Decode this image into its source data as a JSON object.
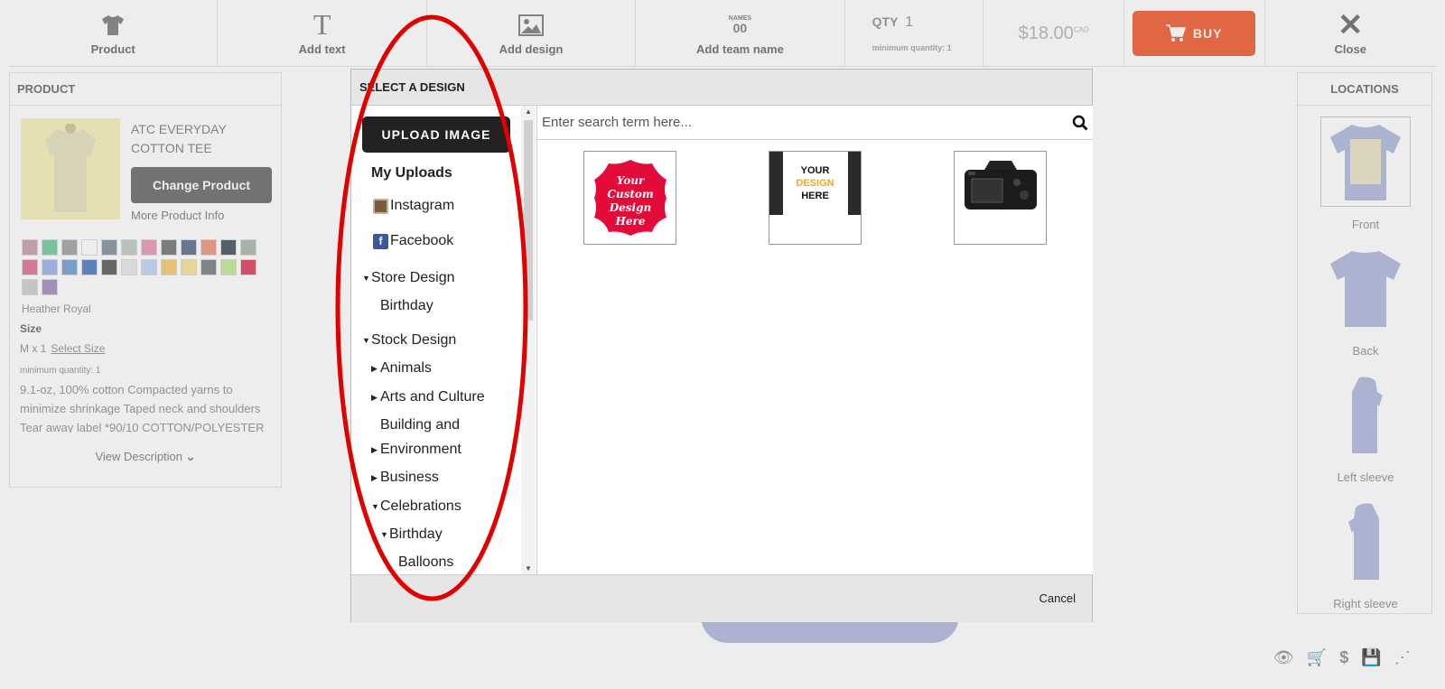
{
  "toolbar": {
    "product": "Product",
    "add_text": "Add text",
    "add_design": "Add design",
    "add_team_name": "Add team name",
    "team_icon_top": "NAMES",
    "team_icon_num": "00",
    "qty_label": "QTY",
    "qty_value": "1",
    "qty_min": "minimum quantity: 1",
    "price": "$18.00",
    "currency": "CAD",
    "buy": "BUY",
    "close": "Close"
  },
  "product_panel": {
    "header": "PRODUCT",
    "name": "ATC EVERYDAY COTTON TEE",
    "change_button": "Change Product",
    "more_info": "More Product Info",
    "swatch_colors": [
      "#c9a9b6",
      "#7fd0a4",
      "#a9aaa9",
      "#ffffff",
      "#8e9aa9",
      "#c6cfc9",
      "#eb9fbe",
      "#7c8480",
      "#6b7b96",
      "#f29f8a",
      "#576168",
      "#b1bfb3",
      "#e27fa4",
      "#a9b8ee",
      "#7ea8d4",
      "#5f87c7",
      "#6a6a6a",
      "#e9e9e9",
      "#c7d8f5",
      "#f7cf7a",
      "#f7e6a0",
      "#868b8e",
      "#c9e9a3",
      "#e0506c",
      "#d2d2d2",
      "#a79ac7"
    ],
    "color_name": "Heather Royal",
    "size_label": "Size",
    "size_value": "M x 1",
    "select_size": "Select Size",
    "min_qty": "minimum quantity: 1",
    "description": "9.1-oz, 100% cotton Compacted yarns to minimize shrinkage Taped neck and shoulders Tear away label *90/10 COTTON/POLYESTER",
    "view_description": "View Description"
  },
  "locations": {
    "header": "LOCATIONS",
    "items": [
      "Front",
      "Back",
      "Left sleeve",
      "Right sleeve"
    ]
  },
  "modal": {
    "title": "SELECT A DESIGN",
    "upload_button": "UPLOAD IMAGE",
    "nav": {
      "my_uploads": "My Uploads",
      "instagram": "Instagram",
      "facebook": "Facebook",
      "store_design": "Store Design",
      "store_birthday": "Birthday",
      "stock_design": "Stock Design",
      "animals": "Animals",
      "arts": "Arts and Culture",
      "building_1": "Building and",
      "building_2": "Environment",
      "business": "Business",
      "celebrations": "Celebrations",
      "cel_birthday": "Birthday",
      "balloons": "Balloons"
    },
    "search_placeholder": "Enter search term here...",
    "designs": {
      "d1_lines": [
        "Your",
        "Custom",
        "Design",
        "Here"
      ],
      "d2_lines": [
        "YOUR",
        "DESIGN",
        "HERE"
      ]
    },
    "cancel": "Cancel"
  },
  "colors": {
    "accent_buy": "#f26a43",
    "annotation": "#e00000"
  }
}
